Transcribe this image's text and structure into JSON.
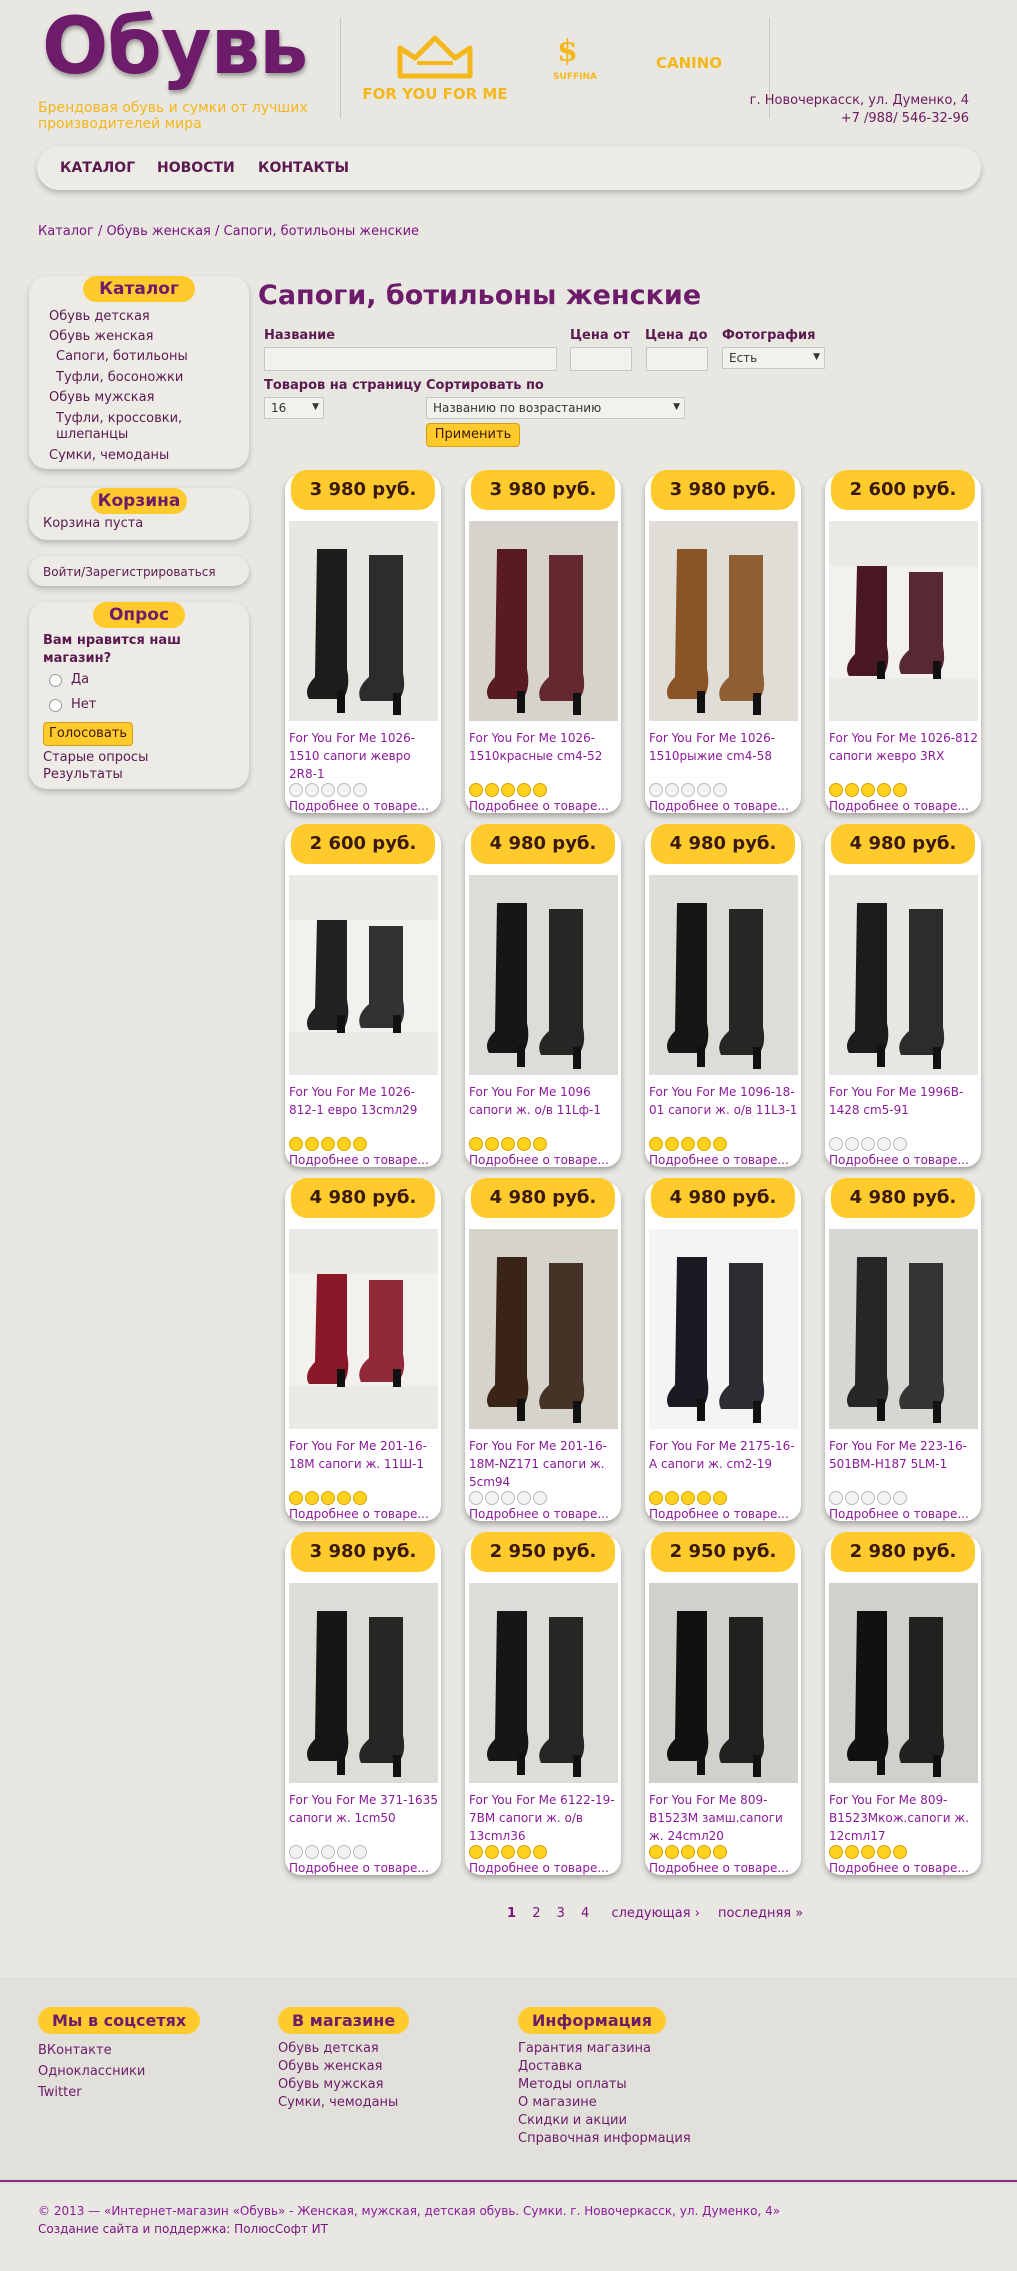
{
  "header": {
    "logo": "Обувь",
    "tagline": "Брендовая обувь и сумки от лучших производителей мира",
    "brands": [
      "FOR YOU FOR ME",
      "SUFFINA",
      "CANINO"
    ],
    "address": "г. Новочеркасск, ул. Думенко, 4",
    "phone": "+7 /988/ 546-32-96"
  },
  "nav": [
    "КАТАЛОГ",
    "НОВОСТИ",
    "КОНТАКТЫ"
  ],
  "breadcrumbs": [
    "Каталог",
    "Обувь женская",
    "Сапоги, ботильоны женские"
  ],
  "sidebar": {
    "catalog_title": "Каталог",
    "catalog": [
      "Обувь детская",
      "Обувь женская",
      "Сапоги, ботильоны",
      "Туфли, босоножки",
      "Обувь мужская",
      "Туфли, кроссовки, шлепанцы",
      "Сумки, чемоданы"
    ],
    "cart_title": "Корзина",
    "cart_text": "Корзина пуста",
    "login": "Войти/Зарегистрироваться",
    "poll_title": "Опрос",
    "poll_question": "Вам нравится наш магазин?",
    "poll_options": [
      "Да",
      "Нет"
    ],
    "vote": "Голосовать",
    "old_polls": "Старые опросы",
    "results": "Результаты"
  },
  "page_title": "Сапоги, ботильоны женские",
  "filters": {
    "name_label": "Название",
    "price_from_label": "Цена от",
    "price_to_label": "Цена до",
    "photo_label": "Фотография",
    "photo_value": "Есть",
    "per_page_label": "Товаров на страницу",
    "per_page_value": "16",
    "sort_label": "Сортировать по",
    "sort_value": "Названию по возрастанию",
    "apply": "Применить"
  },
  "more_label": "Подробнее о товаре...",
  "products": [
    {
      "price": "3 980 руб.",
      "name": "For You For Me 1026-1510 сапоги жевро 2R8-1",
      "rating": 0,
      "img": "pair-black"
    },
    {
      "price": "3 980 руб.",
      "name": "For You For Me 1026-1510красные cm4-52",
      "rating": 5,
      "img": "pair-burgundy"
    },
    {
      "price": "3 980 руб.",
      "name": "For You For Me 1026-1510рыжие cm4-58",
      "rating": 0,
      "img": "pair-brown"
    },
    {
      "price": "2 600 руб.",
      "name": "For You For Me 1026-812 сапоги жевро 3RX",
      "rating": 5,
      "img": "short-burgundy"
    },
    {
      "price": "2 600 руб.",
      "name": "For You For Me 1026-812-1 евро 13cmл29",
      "rating": 5,
      "img": "short-black"
    },
    {
      "price": "4 980 руб.",
      "name": "For You For Me 1096 сапоги ж. о/в 11Lф-1",
      "rating": 5,
      "img": "tall-black"
    },
    {
      "price": "4 980 руб.",
      "name": "For You For Me 1096-18-01 сапоги ж. о/в 11L3-1",
      "rating": 5,
      "img": "tall-black"
    },
    {
      "price": "4 980 руб.",
      "name": "For You For Me 1996B-1428 cm5-91",
      "rating": 0,
      "img": "pair-black"
    },
    {
      "price": "4 980 руб.",
      "name": "For You For Me 201-16-18M сапоги ж. 11Ш-1",
      "rating": 5,
      "img": "flat-red"
    },
    {
      "price": "4 980 руб.",
      "name": "For You For Me 201-16-18M-NZ171 сапоги ж. 5cm94",
      "rating": 0,
      "img": "pair-darkbrown"
    },
    {
      "price": "4 980 руб.",
      "name": "For You For Me 2175-16-A сапоги ж. cm2-19",
      "rating": 5,
      "img": "stiletto"
    },
    {
      "price": "4 980 руб.",
      "name": "For You For Me 223-16-501BM-H187 5LM-1",
      "rating": 0,
      "img": "croc-black"
    },
    {
      "price": "3 980 руб.",
      "name": "For You For Me 371-1635 сапоги ж. 1cm50",
      "rating": 0,
      "img": "tall-black"
    },
    {
      "price": "2 950 руб.",
      "name": "For You For Me 6122-19-7BM сапоги ж. о/в 13cmл36",
      "rating": 5,
      "img": "tall-black"
    },
    {
      "price": "2 950 руб.",
      "name": "For You For Me 809-B1523M замш.сапоги ж. 24cmл20",
      "rating": 5,
      "img": "suede-black"
    },
    {
      "price": "2 980 руб.",
      "name": "For You For Me 809-B1523Mкож.сапоги ж. 12cmл17",
      "rating": 5,
      "img": "suede-black"
    }
  ],
  "pager": {
    "pages": [
      "1",
      "2",
      "3",
      "4"
    ],
    "next": "следующая ›",
    "last": "последняя »"
  },
  "footer": {
    "social_title": "Мы в соцсетях",
    "social": [
      "ВКонтакте",
      "Одноклассники",
      "Twitter"
    ],
    "shop_title": "В магазине",
    "shop": [
      "Обувь детская",
      "Обувь женская",
      "Обувь мужская",
      "Сумки, чемоданы"
    ],
    "info_title": "Информация",
    "info": [
      "Гарантия магазина",
      "Доставка",
      "Методы оплаты",
      "О магазине",
      "Скидки и акции",
      "Справочная информация"
    ],
    "copyright": "© 2013 — «Интернет-магазин «Обувь» - Женская, мужская, детская обувь. Сумки. г. Новочеркасск, ул. Думенко, 4»",
    "credits": "Создание сайта и поддержка: ПолюсСофт ИТ"
  }
}
